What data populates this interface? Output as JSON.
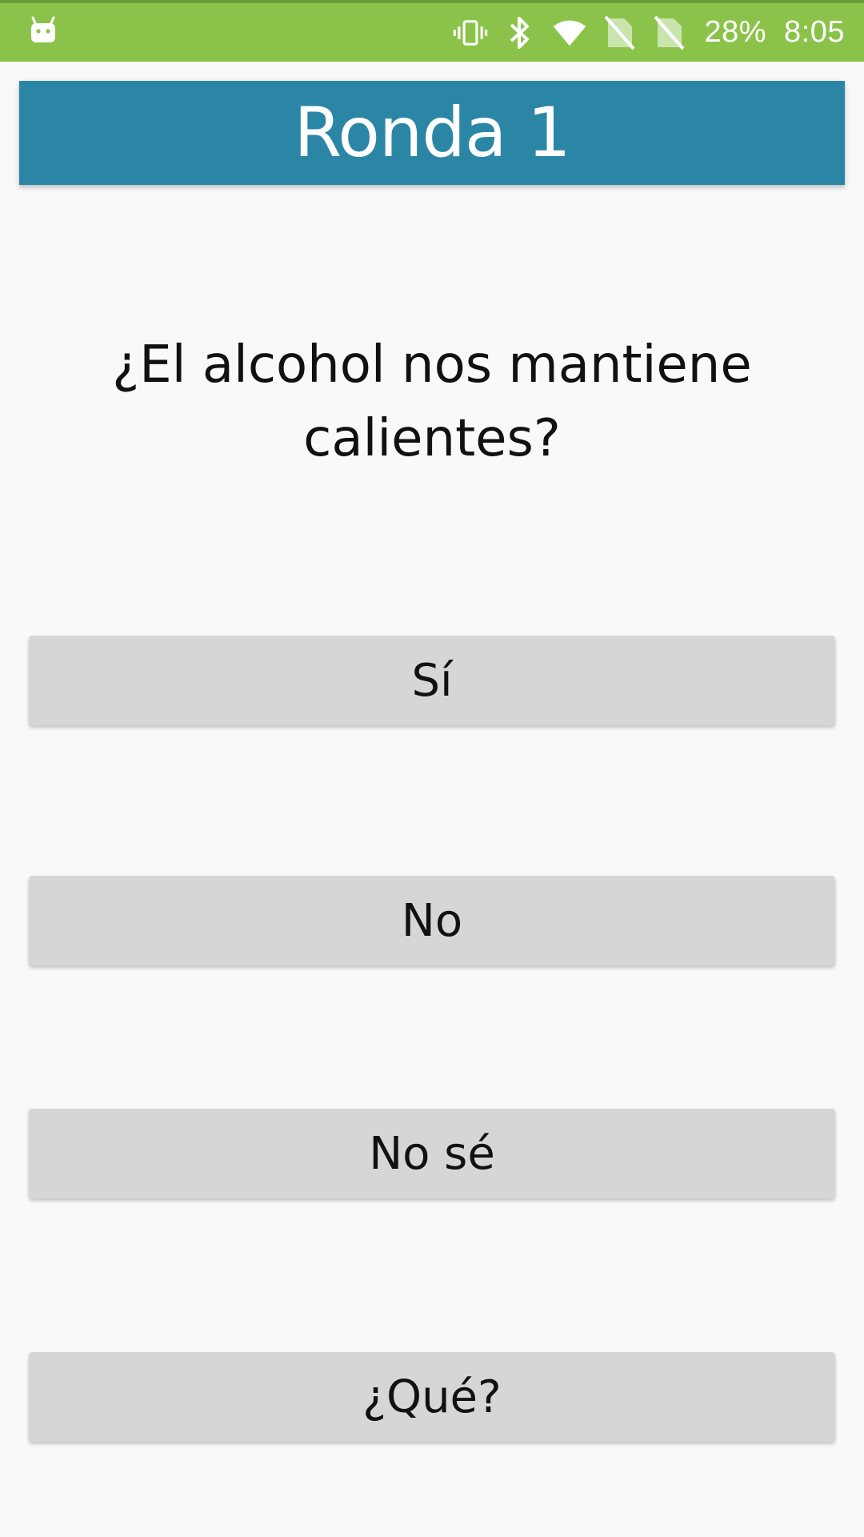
{
  "status_bar": {
    "battery_percent": "28%",
    "time": "8:05",
    "icons": [
      "android-notification-icon",
      "vibrate-icon",
      "bluetooth-icon",
      "wifi-icon",
      "no-sim-icon",
      "no-sim-icon"
    ],
    "background_color": "#8bc34a"
  },
  "header": {
    "title": "Ronda 1",
    "background_color": "#2b86a6"
  },
  "question": {
    "text": "¿El alcohol nos mantiene calientes?"
  },
  "answers": [
    {
      "label": "Sí"
    },
    {
      "label": "No"
    },
    {
      "label": "No sé"
    },
    {
      "label": "¿Qué?"
    }
  ]
}
